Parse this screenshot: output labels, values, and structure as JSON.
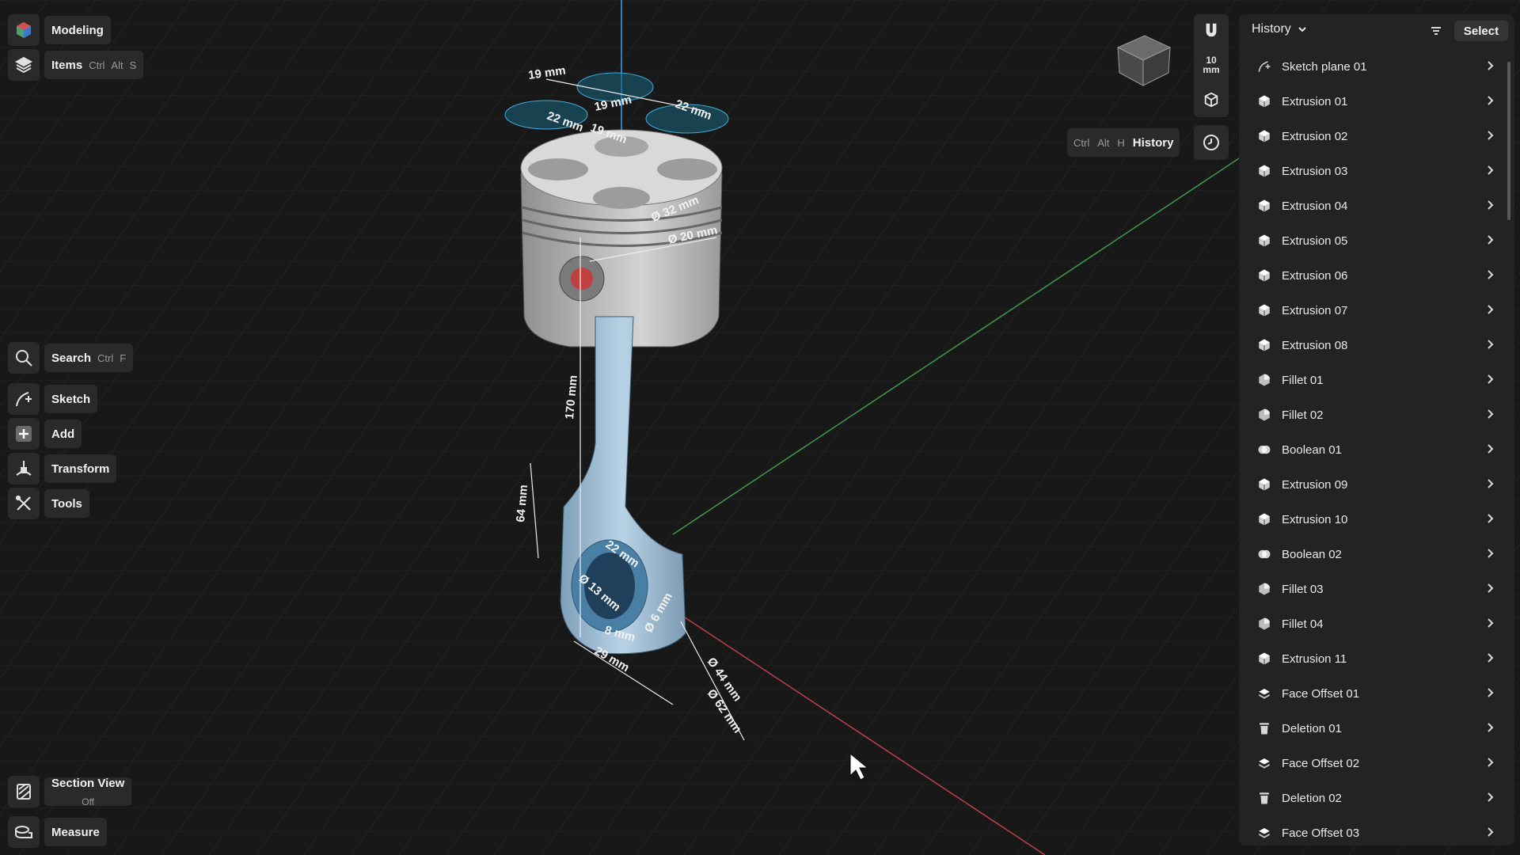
{
  "left_toolbar": {
    "workspace": {
      "label": "Modeling"
    },
    "items": {
      "label": "Items",
      "shortcut": [
        "Ctrl",
        "Alt",
        "S"
      ]
    },
    "search": {
      "label": "Search",
      "shortcut": [
        "Ctrl",
        "F"
      ]
    },
    "sketch": {
      "label": "Sketch"
    },
    "add": {
      "label": "Add"
    },
    "transform": {
      "label": "Transform"
    },
    "tools": {
      "label": "Tools"
    },
    "section_view": {
      "label": "Section View",
      "state": "Off"
    },
    "measure": {
      "label": "Measure"
    }
  },
  "view_controls": {
    "units": {
      "value": "10",
      "unit": "mm"
    },
    "history_hint": {
      "shortcut": [
        "Ctrl",
        "Alt",
        "H"
      ],
      "label": "History"
    }
  },
  "dimensions": {
    "top_1": "19 mm",
    "top_2": "19 mm",
    "top_3": "22 mm",
    "top_4": "22 mm",
    "top_5": "19 mm",
    "dia_32": "Ø 32 mm",
    "dia_20": "Ø 20 mm",
    "len_170": "170 mm",
    "len_64": "64 mm",
    "len_22": "22 mm",
    "dia_13": "Ø 13 mm",
    "len_8": "8 mm",
    "dia_6": "Ø 6 mm",
    "len_29": "29 mm",
    "dia_44": "Ø 44 mm",
    "dia_62": "Ø 62 mm"
  },
  "history_panel": {
    "title": "History",
    "select_label": "Select",
    "items": [
      {
        "label": "Sketch plane 01",
        "icon": "sketch-plane-icon"
      },
      {
        "label": "Extrusion 01",
        "icon": "extrusion-icon"
      },
      {
        "label": "Extrusion 02",
        "icon": "extrusion-icon"
      },
      {
        "label": "Extrusion 03",
        "icon": "extrusion-icon"
      },
      {
        "label": "Extrusion 04",
        "icon": "extrusion-icon"
      },
      {
        "label": "Extrusion 05",
        "icon": "extrusion-icon"
      },
      {
        "label": "Extrusion 06",
        "icon": "extrusion-icon"
      },
      {
        "label": "Extrusion 07",
        "icon": "extrusion-icon"
      },
      {
        "label": "Extrusion 08",
        "icon": "extrusion-icon"
      },
      {
        "label": "Fillet 01",
        "icon": "fillet-icon"
      },
      {
        "label": "Fillet 02",
        "icon": "fillet-icon"
      },
      {
        "label": "Boolean 01",
        "icon": "boolean-icon"
      },
      {
        "label": "Extrusion 09",
        "icon": "extrusion-icon"
      },
      {
        "label": "Extrusion 10",
        "icon": "extrusion-icon"
      },
      {
        "label": "Boolean 02",
        "icon": "boolean-icon"
      },
      {
        "label": "Fillet 03",
        "icon": "fillet-icon"
      },
      {
        "label": "Fillet 04",
        "icon": "fillet-icon"
      },
      {
        "label": "Extrusion 11",
        "icon": "extrusion-icon"
      },
      {
        "label": "Face Offset 01",
        "icon": "face-offset-icon"
      },
      {
        "label": "Deletion 01",
        "icon": "trash-icon"
      },
      {
        "label": "Face Offset 02",
        "icon": "face-offset-icon"
      },
      {
        "label": "Deletion 02",
        "icon": "trash-icon"
      },
      {
        "label": "Face Offset 03",
        "icon": "face-offset-icon"
      }
    ]
  },
  "colors": {
    "background": "#181818",
    "panel": "#232323",
    "button": "#2a2a2a",
    "axis_x": "#c0404a",
    "axis_y": "#3e9a4c",
    "axis_z": "#2f7ec4",
    "sketch_fill": "#1b5f78",
    "part_fill": "#a9c7dc"
  }
}
